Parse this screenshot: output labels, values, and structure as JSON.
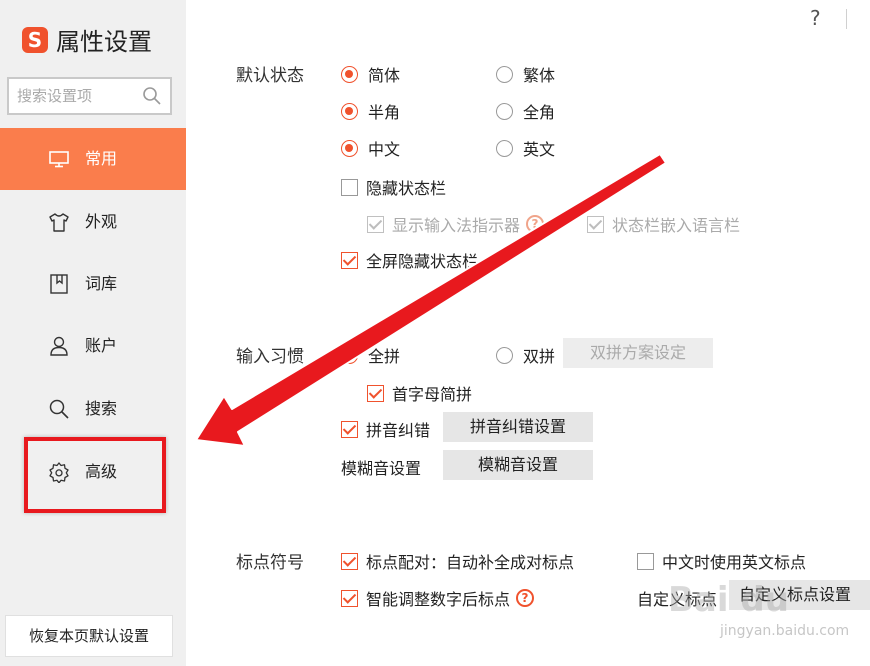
{
  "app": {
    "logo_glyph": "S",
    "title": "属性设置"
  },
  "search": {
    "placeholder": "搜索设置项"
  },
  "sidebar": {
    "items": [
      {
        "label": "常用",
        "icon": "monitor-icon",
        "active": true
      },
      {
        "label": "外观",
        "icon": "shirt-icon",
        "active": false
      },
      {
        "label": "词库",
        "icon": "bookmark-book-icon",
        "active": false
      },
      {
        "label": "账户",
        "icon": "user-icon",
        "active": false
      },
      {
        "label": "搜索",
        "icon": "search-icon",
        "active": false
      },
      {
        "label": "高级",
        "icon": "gear-icon",
        "active": false
      }
    ],
    "restore_label": "恢复本页默认设置"
  },
  "topbar": {
    "help_label": "?"
  },
  "default_state": {
    "label": "默认状态",
    "simplified": "简体",
    "traditional": "繁体",
    "half_width": "半角",
    "full_width": "全角",
    "chinese": "中文",
    "english": "英文",
    "hide_status_bar": "隐藏状态栏",
    "show_ime_indicator": "显示输入法指示器",
    "status_bar_lang_bar": "状态栏嵌入语言栏",
    "fullscreen_hide_status": "全屏隐藏状态栏"
  },
  "input_habit": {
    "label": "输入习惯",
    "full_pinyin": "全拼",
    "double_pinyin": "双拼",
    "double_pinyin_settings": "双拼方案设定",
    "initial_abbrev": "首字母简拼",
    "pinyin_correction": "拼音纠错",
    "pinyin_correction_settings": "拼音纠错设置",
    "fuzzy_settings_label": "模糊音设置",
    "fuzzy_settings_button": "模糊音设置"
  },
  "punctuation": {
    "label": "标点符号",
    "pairing": "标点配对：自动补全成对标点",
    "english_in_chinese": "中文时使用英文标点",
    "smart_adjust": "智能调整数字后标点",
    "custom_label": "自定义标点",
    "custom_button": "自定义标点设置"
  },
  "watermark": {
    "text": "Bai du",
    "url": "jingyan.baidu.com"
  },
  "colors": {
    "accent": "#f0522d",
    "active_nav": "#fa7d4c",
    "annotation_red": "#e8191e"
  }
}
